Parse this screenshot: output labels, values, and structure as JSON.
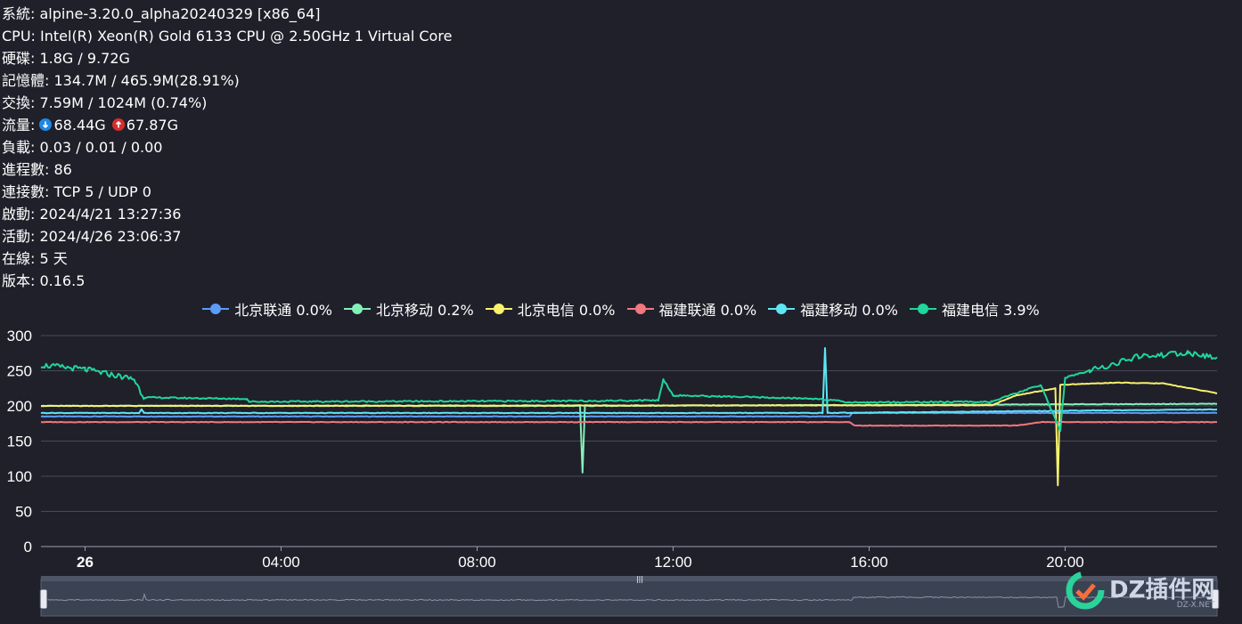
{
  "sysinfo": {
    "rows": [
      {
        "label": "系統: ",
        "value": "alpine-3.20.0_alpha20240329 [x86_64]"
      },
      {
        "label": "CPU: ",
        "value": "Intel(R) Xeon(R) Gold 6133 CPU @ 2.50GHz 1 Virtual Core"
      },
      {
        "label": "硬碟: ",
        "value": "1.8G / 9.72G"
      },
      {
        "label": "記憶體: ",
        "value": "134.7M / 465.9M(28.91%)"
      },
      {
        "label": "交換: ",
        "value": "7.59M / 1024M (0.74%)"
      }
    ],
    "traffic_label": "流量: ",
    "traffic_down": "68.44G",
    "traffic_up": "67.87G",
    "traffic_down_icon": "download-arrow-icon",
    "traffic_up_icon": "upload-arrow-icon",
    "rows2": [
      {
        "label": "負載: ",
        "value": "0.03 / 0.01 / 0.00"
      },
      {
        "label": "進程數: ",
        "value": "86"
      },
      {
        "label": "連接數: ",
        "value": "TCP 5 / UDP 0"
      },
      {
        "label": "啟動: ",
        "value": "2024/4/21 13:27:36"
      },
      {
        "label": "活動: ",
        "value": "2024/4/26 23:06:37"
      },
      {
        "label": "在線: ",
        "value": "5 天"
      },
      {
        "label": "版本: ",
        "value": "0.16.5"
      }
    ]
  },
  "legend": [
    {
      "label": "北京联通 0.0%",
      "color": "#5b9cf6"
    },
    {
      "label": "北京移动 0.2%",
      "color": "#84f0b8"
    },
    {
      "label": "北京电信 0.0%",
      "color": "#f8f26c"
    },
    {
      "label": "福建联通 0.0%",
      "color": "#f2777e"
    },
    {
      "label": "福建移动 0.0%",
      "color": "#5ee6f5"
    },
    {
      "label": "福建电信 3.9%",
      "color": "#1fd69c"
    }
  ],
  "chart_data": {
    "type": "line",
    "xlabel": "",
    "ylabel": "",
    "x_ticks": [
      "26",
      "04:00",
      "08:00",
      "12:00",
      "16:00",
      "20:00"
    ],
    "x_tick_hours": [
      0,
      4,
      8,
      12,
      16,
      20
    ],
    "xlim_hours": [
      -0.9,
      23.1
    ],
    "ylim": [
      0,
      300
    ],
    "y_ticks": [
      0,
      50,
      100,
      150,
      200,
      250,
      300
    ],
    "grid": true,
    "legend_position": "top-center",
    "series": [
      {
        "name": "北京联通",
        "color": "#5b9cf6",
        "points": [
          [
            -0.9,
            185
          ],
          [
            15.6,
            185
          ],
          [
            15.65,
            190
          ],
          [
            23.1,
            190
          ]
        ]
      },
      {
        "name": "北京移动",
        "color": "#84f0b8",
        "points": [
          [
            -0.9,
            200
          ],
          [
            10.1,
            200
          ],
          [
            10.15,
            105
          ],
          [
            10.2,
            200
          ],
          [
            23.1,
            203
          ]
        ]
      },
      {
        "name": "北京电信",
        "color": "#f8f26c",
        "points": [
          [
            -0.9,
            200
          ],
          [
            18.5,
            201
          ],
          [
            19.0,
            215
          ],
          [
            19.8,
            225
          ],
          [
            19.85,
            87
          ],
          [
            19.9,
            230
          ],
          [
            21.0,
            233
          ],
          [
            22.0,
            232
          ],
          [
            23.1,
            218
          ]
        ]
      },
      {
        "name": "福建联通",
        "color": "#f2777e",
        "points": [
          [
            -0.9,
            177
          ],
          [
            15.6,
            177
          ],
          [
            15.7,
            172
          ],
          [
            19.0,
            172
          ],
          [
            19.5,
            177
          ],
          [
            23.1,
            177
          ]
        ]
      },
      {
        "name": "福建移动",
        "color": "#5ee6f5",
        "points": [
          [
            -0.9,
            190
          ],
          [
            1.1,
            190
          ],
          [
            1.15,
            195
          ],
          [
            1.2,
            190
          ],
          [
            15.05,
            190
          ],
          [
            15.1,
            282
          ],
          [
            15.15,
            190
          ],
          [
            23.1,
            195
          ]
        ]
      },
      {
        "name": "福建电信",
        "color": "#1fd69c",
        "points": [
          [
            -0.9,
            258
          ],
          [
            0.0,
            252
          ],
          [
            1.0,
            238
          ],
          [
            1.2,
            212
          ],
          [
            3.3,
            210
          ],
          [
            3.35,
            206
          ],
          [
            10.0,
            207
          ],
          [
            11.7,
            208
          ],
          [
            11.8,
            238
          ],
          [
            12.0,
            215
          ],
          [
            15.0,
            210
          ],
          [
            15.6,
            205
          ],
          [
            18.5,
            206
          ],
          [
            19.5,
            230
          ],
          [
            19.9,
            165
          ],
          [
            20.0,
            240
          ],
          [
            20.5,
            250
          ],
          [
            21.5,
            270
          ],
          [
            22.5,
            275
          ],
          [
            23.1,
            268
          ]
        ]
      }
    ]
  },
  "zoom": {
    "handle_left_icon": "zoom-handle-left-icon",
    "handle_right_icon": "zoom-handle-right-icon",
    "grip_icon": "drag-grip-icon"
  },
  "watermark": {
    "text": "DZ插件网",
    "sub": "DZ-X.NET"
  }
}
